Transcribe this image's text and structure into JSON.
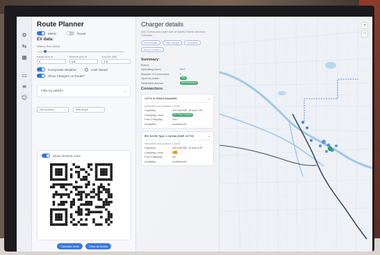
{
  "planner": {
    "title": "Route Planner",
    "toggle_metric": "Metric",
    "toggle_route": "Route",
    "ev_data": "EV data:",
    "battery_label": "Battery Size (kWh)",
    "battery_value": "65",
    "battery_max": "",
    "inputs": [
      {
        "label": "Range (km) at",
        "value": "4"
      },
      {
        "label": "Reserve (km) at",
        "value": "4.8"
      },
      {
        "label": "Aux Pwr (kW)",
        "value": "1.8"
      }
    ],
    "toggle_weather": "Incorporate Weather",
    "limit_speed": "Limit Speed",
    "toggle_show_chargers": "Show Chargers on Route?",
    "filter_label": "Filter by eMSPs",
    "set_location": "Set location",
    "add_stops": "Add stops",
    "show_shortest": "Show shortest route",
    "calculate_button": "Calculate route",
    "clear_button": "Clear all routes"
  },
  "details": {
    "title": "Charger details",
    "address": "100, Dorley Ave (right side of street) Grand Junction, Colorado",
    "chips": [
      "Visit Website",
      "Rate charger",
      "Directions",
      "Report Problem"
    ],
    "summary_title": "Summary:",
    "summary": [
      {
        "k": "Brand:",
        "v": ""
      },
      {
        "k": "Operating hours:",
        "v": "24/7"
      },
      {
        "k": "Number of Connectors:",
        "v": "2"
      },
      {
        "k": "Open to public:",
        "v": "Yes",
        "pill": "g"
      },
      {
        "k": "Restricted access:",
        "v": "Not Restricted",
        "pill": "g"
      }
    ],
    "connectors_title": "Connectors:",
    "connectors": [
      {
        "name": "J1772 & 200A/CHAdeMO",
        "updated": "Information last updated: 1/16/08",
        "rows": [
          {
            "k": "Capacity:",
            "v": "400 kW/350, at max 125"
          },
          {
            "k": "Charging Level:",
            "v": "DC Fast Charger",
            "pill": "g"
          },
          {
            "k": "Fast Charging:",
            "v": "Yes"
          },
          {
            "k": "Available:",
            "v": "undefined/1"
          }
        ]
      },
      {
        "name": "IEC 62196 Type 1 combo (SAE J1772)",
        "updated": "Information last updated: 1/16/08",
        "rows": [
          {
            "k": "Capacity:",
            "v": "400 kW/350, at max 125"
          },
          {
            "k": "Charging Level:",
            "v": "L2",
            "pill": "y"
          },
          {
            "k": "Fast Charging:",
            "v": "No"
          },
          {
            "k": "Available:",
            "v": "undefined/1"
          }
        ]
      }
    ]
  },
  "colors": {
    "accent": "#2f6fe0",
    "green": "#2aa05a",
    "river": "#9cc8e8",
    "road": "#3d4a63"
  }
}
